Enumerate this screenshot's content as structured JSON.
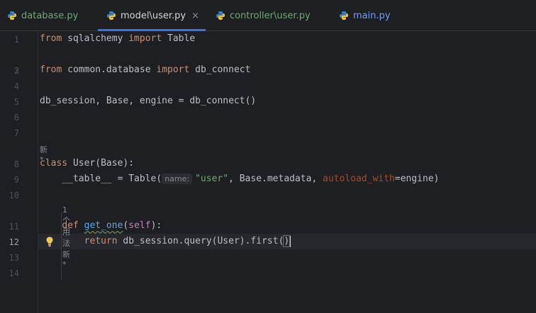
{
  "tabs": [
    {
      "name": "database.py",
      "active": false
    },
    {
      "name": "model\\user.py",
      "active": true,
      "close": "×"
    },
    {
      "name": "controller\\user.py",
      "active": false
    },
    {
      "name": "main.py",
      "active": false
    }
  ],
  "line_numbers": [
    "1",
    "2",
    "3",
    "4",
    "5",
    "6",
    "7",
    "8",
    "9",
    "10",
    "11",
    "12",
    "13",
    "14"
  ],
  "code": {
    "l1": {
      "kw1": "from",
      "mod": " sqlalchemy ",
      "kw2": "import",
      "name": " Table"
    },
    "l3": {
      "kw1": "from",
      "mod": " common.database ",
      "kw2": "import",
      "name": " db_connect"
    },
    "l5": {
      "text": "db_session, Base, engine = db_connect()"
    },
    "meta_class": "新 *",
    "l8": {
      "kw": "class",
      "rest": " User(Base):"
    },
    "l9": {
      "a": "    __table__ = Table(",
      "hint": "name:",
      "str": "\"user\"",
      "b": ", Base.metadata, ",
      "kwarg": "autoload_with",
      "c": "=engine)"
    },
    "meta_def": "1个用法   新 *",
    "l11": {
      "indent": "    ",
      "kw": "def",
      "sp": " ",
      "fn": "get_one",
      "open": "(",
      "param": "self",
      "close": "):"
    },
    "l12": {
      "indent": "        ",
      "kw": "return",
      "rest": " db_session.query(User).first(",
      "close": ")"
    }
  }
}
